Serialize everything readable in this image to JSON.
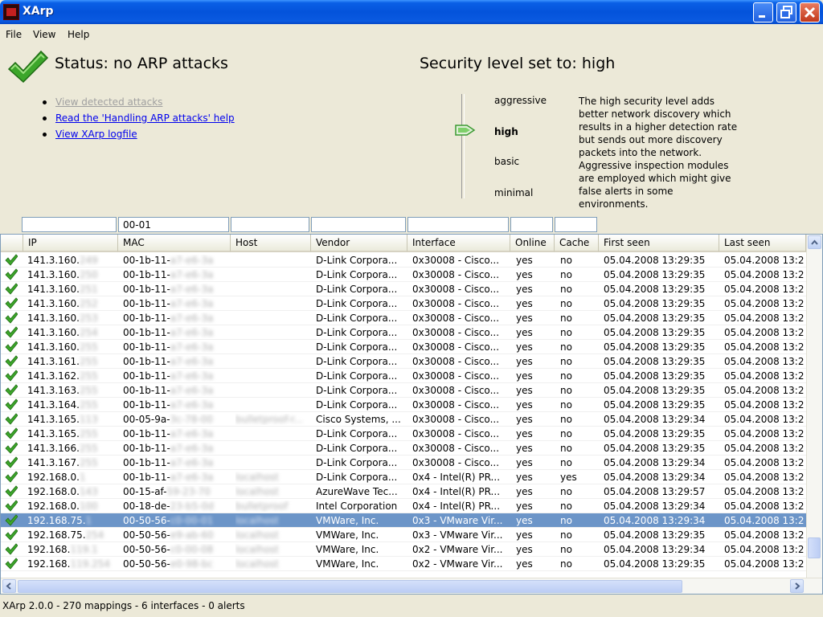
{
  "window": {
    "title": "XArp",
    "app_icon": "xarp-app-icon"
  },
  "menu": [
    {
      "label": "File"
    },
    {
      "label": "View"
    },
    {
      "label": "Help"
    }
  ],
  "status": {
    "label": "Status:  no ARP attacks",
    "icon": "check-icon",
    "ok_color": "#3CA62A"
  },
  "security": {
    "label": "Security level set to:  high",
    "levels": [
      {
        "label": "aggressive"
      },
      {
        "label": "high"
      },
      {
        "label": "basic"
      },
      {
        "label": "minimal"
      }
    ],
    "selected": "high",
    "description": "The high security level adds better network discovery which results in a higher detection rate but sends out more discovery packets into the network. Aggressive inspection modules are employed which might give false alerts in some environments."
  },
  "links": [
    {
      "label": "View detected attacks",
      "enabled": false
    },
    {
      "label": "Read the 'Handling ARP attacks' help",
      "enabled": true
    },
    {
      "label": "View XArp logfile",
      "enabled": true
    }
  ],
  "filters": [
    {
      "value": ""
    },
    {
      "value": "00-01"
    },
    {
      "value": ""
    },
    {
      "value": ""
    },
    {
      "value": ""
    },
    {
      "value": ""
    },
    {
      "value": ""
    }
  ],
  "columns": [
    {
      "label": "IP"
    },
    {
      "label": "MAC"
    },
    {
      "label": "Host"
    },
    {
      "label": "Vendor"
    },
    {
      "label": "Interface"
    },
    {
      "label": "Online"
    },
    {
      "label": "Cache"
    },
    {
      "label": "First seen"
    },
    {
      "label": "Last seen"
    }
  ],
  "rows": [
    {
      "ip": "141.3.160.",
      "ip_hidden": "249",
      "mac": "00-1b-11-",
      "mac_hidden": "a7-e6-3a",
      "host": "",
      "vendor": "D-Link Corpora...",
      "iface": "0x30008 - Cisco...",
      "online": "yes",
      "cache": "no",
      "first": "05.04.2008 13:29:35",
      "last": "05.04.2008 13:2",
      "selected": false
    },
    {
      "ip": "141.3.160.",
      "ip_hidden": "250",
      "mac": "00-1b-11-",
      "mac_hidden": "a7-e6-3a",
      "host": "",
      "vendor": "D-Link Corpora...",
      "iface": "0x30008 - Cisco...",
      "online": "yes",
      "cache": "no",
      "first": "05.04.2008 13:29:35",
      "last": "05.04.2008 13:2",
      "selected": false
    },
    {
      "ip": "141.3.160.",
      "ip_hidden": "251",
      "mac": "00-1b-11-",
      "mac_hidden": "a7-e6-3a",
      "host": "",
      "vendor": "D-Link Corpora...",
      "iface": "0x30008 - Cisco...",
      "online": "yes",
      "cache": "no",
      "first": "05.04.2008 13:29:35",
      "last": "05.04.2008 13:2",
      "selected": false
    },
    {
      "ip": "141.3.160.",
      "ip_hidden": "252",
      "mac": "00-1b-11-",
      "mac_hidden": "a7-e6-3a",
      "host": "",
      "vendor": "D-Link Corpora...",
      "iface": "0x30008 - Cisco...",
      "online": "yes",
      "cache": "no",
      "first": "05.04.2008 13:29:35",
      "last": "05.04.2008 13:2",
      "selected": false
    },
    {
      "ip": "141.3.160.",
      "ip_hidden": "253",
      "mac": "00-1b-11-",
      "mac_hidden": "a7-e6-3a",
      "host": "",
      "vendor": "D-Link Corpora...",
      "iface": "0x30008 - Cisco...",
      "online": "yes",
      "cache": "no",
      "first": "05.04.2008 13:29:35",
      "last": "05.04.2008 13:2",
      "selected": false
    },
    {
      "ip": "141.3.160.",
      "ip_hidden": "254",
      "mac": "00-1b-11-",
      "mac_hidden": "a7-e6-3a",
      "host": "",
      "vendor": "D-Link Corpora...",
      "iface": "0x30008 - Cisco...",
      "online": "yes",
      "cache": "no",
      "first": "05.04.2008 13:29:35",
      "last": "05.04.2008 13:2",
      "selected": false
    },
    {
      "ip": "141.3.160.",
      "ip_hidden": "255",
      "mac": "00-1b-11-",
      "mac_hidden": "a7-e6-3a",
      "host": "",
      "vendor": "D-Link Corpora...",
      "iface": "0x30008 - Cisco...",
      "online": "yes",
      "cache": "no",
      "first": "05.04.2008 13:29:35",
      "last": "05.04.2008 13:2",
      "selected": false
    },
    {
      "ip": "141.3.161.",
      "ip_hidden": "255",
      "mac": "00-1b-11-",
      "mac_hidden": "a7-e6-3a",
      "host": "",
      "vendor": "D-Link Corpora...",
      "iface": "0x30008 - Cisco...",
      "online": "yes",
      "cache": "no",
      "first": "05.04.2008 13:29:35",
      "last": "05.04.2008 13:2",
      "selected": false
    },
    {
      "ip": "141.3.162.",
      "ip_hidden": "255",
      "mac": "00-1b-11-",
      "mac_hidden": "a7-e6-3a",
      "host": "",
      "vendor": "D-Link Corpora...",
      "iface": "0x30008 - Cisco...",
      "online": "yes",
      "cache": "no",
      "first": "05.04.2008 13:29:35",
      "last": "05.04.2008 13:2",
      "selected": false
    },
    {
      "ip": "141.3.163.",
      "ip_hidden": "255",
      "mac": "00-1b-11-",
      "mac_hidden": "a7-e6-3a",
      "host": "",
      "vendor": "D-Link Corpora...",
      "iface": "0x30008 - Cisco...",
      "online": "yes",
      "cache": "no",
      "first": "05.04.2008 13:29:35",
      "last": "05.04.2008 13:2",
      "selected": false
    },
    {
      "ip": "141.3.164.",
      "ip_hidden": "255",
      "mac": "00-1b-11-",
      "mac_hidden": "a7-e6-3a",
      "host": "",
      "vendor": "D-Link Corpora...",
      "iface": "0x30008 - Cisco...",
      "online": "yes",
      "cache": "no",
      "first": "05.04.2008 13:29:35",
      "last": "05.04.2008 13:2",
      "selected": false
    },
    {
      "ip": "141.3.165.",
      "ip_hidden": "113",
      "mac": "00-05-9a-",
      "mac_hidden": "3c-78-00",
      "host": "",
      "host_hidden": "bulletproof-r...",
      "vendor": "Cisco Systems, ...",
      "iface": "0x30008 - Cisco...",
      "online": "yes",
      "cache": "no",
      "first": "05.04.2008 13:29:34",
      "last": "05.04.2008 13:2",
      "selected": false
    },
    {
      "ip": "141.3.165.",
      "ip_hidden": "255",
      "mac": "00-1b-11-",
      "mac_hidden": "a7-e6-3a",
      "host": "",
      "vendor": "D-Link Corpora...",
      "iface": "0x30008 - Cisco...",
      "online": "yes",
      "cache": "no",
      "first": "05.04.2008 13:29:35",
      "last": "05.04.2008 13:2",
      "selected": false
    },
    {
      "ip": "141.3.166.",
      "ip_hidden": "255",
      "mac": "00-1b-11-",
      "mac_hidden": "a7-e6-3a",
      "host": "",
      "vendor": "D-Link Corpora...",
      "iface": "0x30008 - Cisco...",
      "online": "yes",
      "cache": "no",
      "first": "05.04.2008 13:29:35",
      "last": "05.04.2008 13:2",
      "selected": false
    },
    {
      "ip": "141.3.167.",
      "ip_hidden": "255",
      "mac": "00-1b-11-",
      "mac_hidden": "a7-e6-3a",
      "host": "",
      "vendor": "D-Link Corpora...",
      "iface": "0x30008 - Cisco...",
      "online": "yes",
      "cache": "no",
      "first": "05.04.2008 13:29:34",
      "last": "05.04.2008 13:2",
      "selected": false
    },
    {
      "ip": "192.168.0.",
      "ip_hidden": "1",
      "mac": "00-1b-11-",
      "mac_hidden": "a7-e6-3a",
      "host": "",
      "host_hidden": "localhost",
      "vendor": "D-Link Corpora...",
      "iface": "0x4 - Intel(R) PR...",
      "online": "yes",
      "cache": "yes",
      "first": "05.04.2008 13:29:34",
      "last": "05.04.2008 13:2",
      "selected": false
    },
    {
      "ip": "192.168.0.",
      "ip_hidden": "143",
      "mac": "00-15-af-",
      "mac_hidden": "59-23-70",
      "host": "",
      "host_hidden": "localhost",
      "vendor": "AzureWave Tec...",
      "iface": "0x4 - Intel(R) PR...",
      "online": "yes",
      "cache": "no",
      "first": "05.04.2008 13:29:57",
      "last": "05.04.2008 13:2",
      "selected": false
    },
    {
      "ip": "192.168.0.",
      "ip_hidden": "100",
      "mac": "00-18-de-",
      "mac_hidden": "23-b5-0d",
      "host": "",
      "host_hidden": "bulletproof",
      "vendor": "Intel Corporation",
      "iface": "0x4 - Intel(R) PR...",
      "online": "yes",
      "cache": "no",
      "first": "05.04.2008 13:29:34",
      "last": "05.04.2008 13:2",
      "selected": false
    },
    {
      "ip": "192.168.75.",
      "ip_hidden": "1",
      "mac": "00-50-56-",
      "mac_hidden": "c0-00-01",
      "host": "",
      "host_hidden": "localhost",
      "vendor": "VMWare, Inc.",
      "iface": "0x3 - VMware Vir...",
      "online": "yes",
      "cache": "no",
      "first": "05.04.2008 13:29:34",
      "last": "05.04.2008 13:2",
      "selected": true
    },
    {
      "ip": "192.168.75.",
      "ip_hidden": "254",
      "mac": "00-50-56-",
      "mac_hidden": "e9-ab-60",
      "host": "",
      "host_hidden": "localhost",
      "vendor": "VMWare, Inc.",
      "iface": "0x3 - VMware Vir...",
      "online": "yes",
      "cache": "no",
      "first": "05.04.2008 13:29:35",
      "last": "05.04.2008 13:2",
      "selected": false
    },
    {
      "ip": "192.168.",
      "ip_hidden": "119.1",
      "mac": "00-50-56-",
      "mac_hidden": "c0-00-08",
      "host": "",
      "host_hidden": "localhost",
      "vendor": "VMWare, Inc.",
      "iface": "0x2 - VMware Vir...",
      "online": "yes",
      "cache": "no",
      "first": "05.04.2008 13:29:34",
      "last": "05.04.2008 13:2",
      "selected": false
    },
    {
      "ip": "192.168.",
      "ip_hidden": "119.254",
      "mac": "00-50-56-",
      "mac_hidden": "e0-98-bc",
      "host": "",
      "host_hidden": "localhost",
      "vendor": "VMWare, Inc.",
      "iface": "0x2 - VMware Vir...",
      "online": "yes",
      "cache": "no",
      "first": "05.04.2008 13:29:35",
      "last": "05.04.2008 13:2",
      "selected": false
    }
  ],
  "statusbar": {
    "text": "XArp 2.0.0  -  270 mappings  -  6 interfaces  -  0 alerts"
  }
}
